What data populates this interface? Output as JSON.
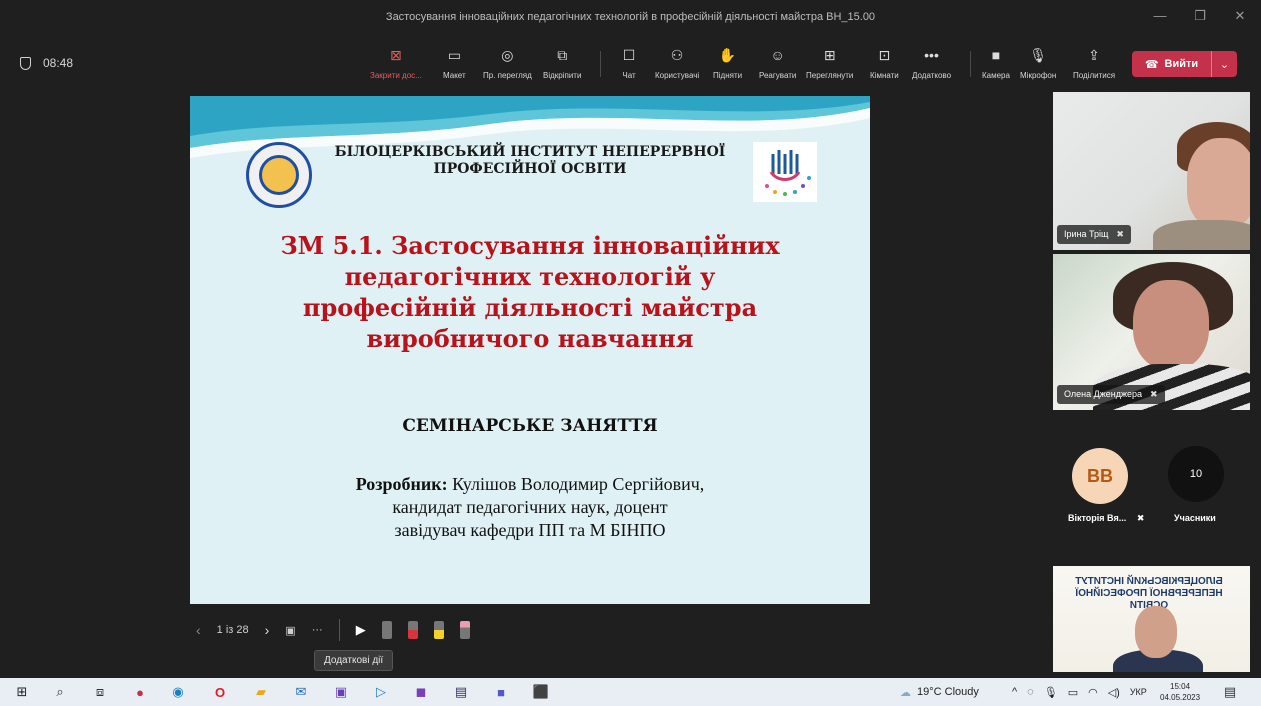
{
  "window": {
    "title": "Застосування інноваційних педагогічних технологій в професійній діяльності майстра ВН_15.00"
  },
  "meeting": {
    "time": "08:48",
    "toolbar": [
      {
        "icon": "close-share-icon",
        "label": "Закрити дос..."
      },
      {
        "icon": "layout-icon",
        "label": "Макет"
      },
      {
        "icon": "preview-icon",
        "label": "Пр. перегляд"
      },
      {
        "icon": "popout-icon",
        "label": "Відкріпити"
      },
      {
        "icon": "chat-icon",
        "label": "Чат"
      },
      {
        "icon": "people-icon",
        "label": "Користувачі"
      },
      {
        "icon": "raise-hand-icon",
        "label": "Підняти"
      },
      {
        "icon": "react-icon",
        "label": "Реагувати"
      },
      {
        "icon": "view-icon",
        "label": "Переглянути"
      },
      {
        "icon": "rooms-icon",
        "label": "Кімнати"
      },
      {
        "icon": "more-icon",
        "label": "Додатково"
      },
      {
        "icon": "camera-icon",
        "label": "Камера"
      },
      {
        "icon": "mic-icon",
        "label": "Мікрофон"
      },
      {
        "icon": "share-icon",
        "label": "Поділитися"
      }
    ],
    "leave_label": "Вийти"
  },
  "slide": {
    "institute": "БІЛОЦЕРКІВСЬКИЙ ІНСТИТУТ НЕПЕРЕРВНОЇ ПРОФЕСІЙНОЇ ОСВІТИ",
    "heading_lines": [
      "ЗМ 5.1. Застосування інноваційних",
      "педагогічних технологій у",
      "професійній діяльності майстра",
      "виробничого навчання"
    ],
    "seminar": "СЕМІНАРСЬКЕ ЗАНЯТТЯ",
    "author_label": "Розробник:",
    "author_name": " Кулішов Володимир Сергійович,",
    "author_line2": "кандидат педагогічних наук, доцент",
    "author_line3": "завідувач кафедри ПП та М БІНПО"
  },
  "slide_nav": {
    "counter": "1 із 28",
    "more_tooltip": "Додаткові дії"
  },
  "participants": {
    "p1": "Ірина Тріщ",
    "p2": "Олена Дженджера",
    "p3_initials": "ВВ",
    "p3_name": "Вікторія Вя...",
    "count": "10",
    "count_label": "Учасники",
    "banner_text": "БІЛОЦЕРКІВСЬКИЙ ІНСТИТУТ НЕПЕРЕРВНОЇ ПРОФЕСІЙНОЇ ОСВІТИ"
  },
  "taskbar": {
    "weather": "19°C  Cloudy",
    "lang": "УКР",
    "time": "15:04",
    "date": "04.05.2023"
  },
  "colors": {
    "leave": "#c4314b",
    "slide_heading": "#b8121b",
    "slide_bg": "#dff1f4"
  }
}
